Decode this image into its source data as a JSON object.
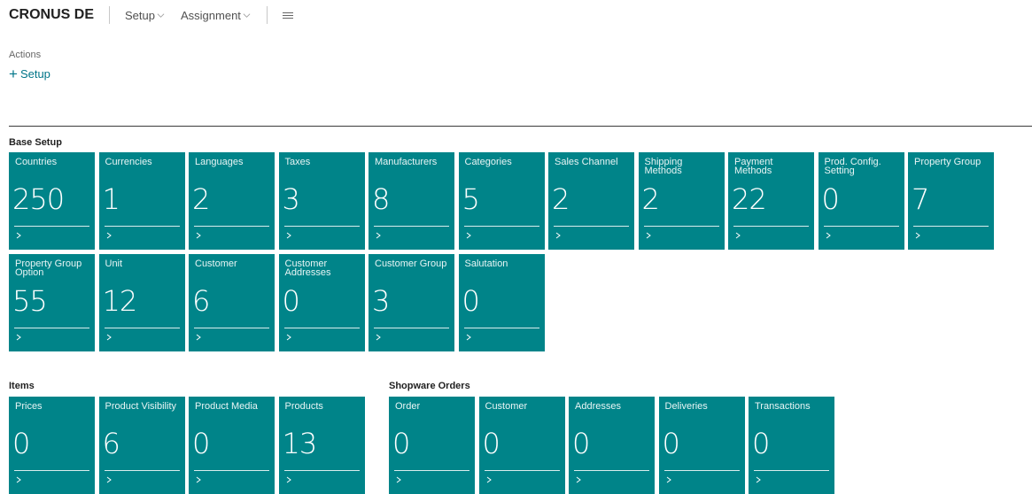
{
  "header": {
    "brand": "CRONUS DE",
    "menus": [
      "Setup",
      "Assignment"
    ]
  },
  "actions": {
    "label": "Actions",
    "setup": "Setup"
  },
  "groups": {
    "base_setup": {
      "title": "Base Setup",
      "tiles": [
        {
          "label": "Countries",
          "value": "250"
        },
        {
          "label": "Currencies",
          "value": "1"
        },
        {
          "label": "Languages",
          "value": "2"
        },
        {
          "label": "Taxes",
          "value": "3"
        },
        {
          "label": "Manufacturers",
          "value": "8"
        },
        {
          "label": "Categories",
          "value": "5"
        },
        {
          "label": "Sales Channel",
          "value": "2"
        },
        {
          "label": "Shipping Methods",
          "value": "2"
        },
        {
          "label": "Payment Methods",
          "value": "22"
        },
        {
          "label": "Prod. Config. Setting",
          "value": "0"
        },
        {
          "label": "Property Group",
          "value": "7"
        },
        {
          "label": "Property Group Option",
          "value": "55"
        },
        {
          "label": "Unit",
          "value": "12"
        },
        {
          "label": "Customer",
          "value": "6"
        },
        {
          "label": "Customer Addresses",
          "value": "0"
        },
        {
          "label": "Customer Group",
          "value": "3"
        },
        {
          "label": "Salutation",
          "value": "0"
        }
      ]
    },
    "items": {
      "title": "Items",
      "tiles": [
        {
          "label": "Prices",
          "value": "0"
        },
        {
          "label": "Product Visibility",
          "value": "6"
        },
        {
          "label": "Product Media",
          "value": "0"
        },
        {
          "label": "Products",
          "value": "13"
        }
      ]
    },
    "orders": {
      "title": "Shopware Orders",
      "tiles": [
        {
          "label": "Order",
          "value": "0"
        },
        {
          "label": "Customer",
          "value": "0"
        },
        {
          "label": "Addresses",
          "value": "0"
        },
        {
          "label": "Deliveries",
          "value": "0"
        },
        {
          "label": "Transactions",
          "value": "0"
        }
      ]
    }
  },
  "colors": {
    "tile": "#008489",
    "accent": "#007589"
  }
}
